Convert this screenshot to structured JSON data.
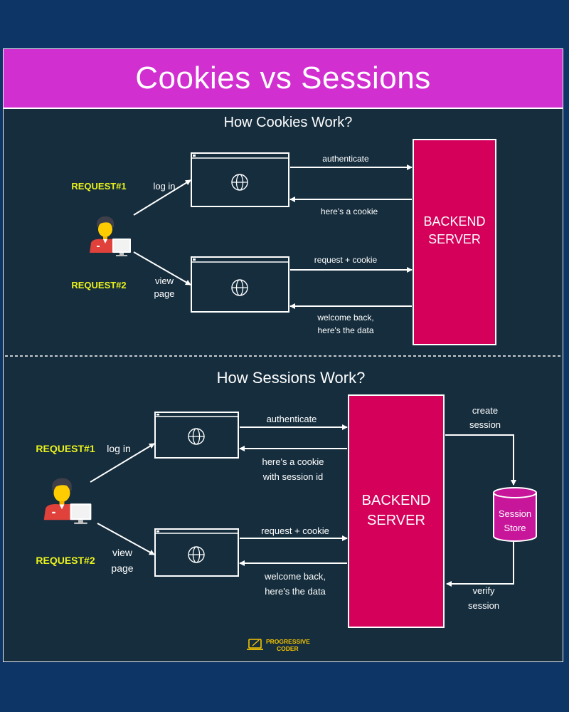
{
  "title": "Cookies vs Sessions",
  "colors": {
    "page_background": "#0d3566",
    "panel_background": "#152d3d",
    "title_bar": "#d12fd0",
    "server": "#d5005a",
    "session_store": "#c8169b",
    "request_label": "#eaf21c",
    "line": "#ffffff"
  },
  "cookies": {
    "heading": "How Cookies Work?",
    "request1_label": "REQUEST#1",
    "request2_label": "REQUEST#2",
    "login_label": "log in",
    "view_label": [
      "view",
      "page"
    ],
    "authenticate_label": "authenticate",
    "cookie_reply_label": "here's a cookie",
    "request_cookie_label": "request + cookie",
    "welcome_label": [
      "welcome back,",
      "here's the data"
    ],
    "server_label": [
      "BACKEND",
      "SERVER"
    ]
  },
  "sessions": {
    "heading": "How Sessions Work?",
    "request1_label": "REQUEST#1",
    "request2_label": "REQUEST#2",
    "login_label": "log in",
    "view_label": [
      "view",
      "page"
    ],
    "authenticate_label": "authenticate",
    "cookie_reply_label": [
      "here's a cookie",
      "with session id"
    ],
    "request_cookie_label": "request + cookie",
    "welcome_label": [
      "welcome back,",
      "here's the data"
    ],
    "server_label": [
      "BACKEND",
      "SERVER"
    ],
    "create_label": [
      "create",
      "session"
    ],
    "verify_label": [
      "verify",
      "session"
    ],
    "store_label": [
      "Session",
      "Store"
    ]
  },
  "logo": {
    "line1": "PROGRESSIVE",
    "line2": "CODER",
    "icon": "laptop-pen-icon"
  },
  "icons": {
    "browser": "globe-icon",
    "user": "user-at-computer-icon"
  }
}
